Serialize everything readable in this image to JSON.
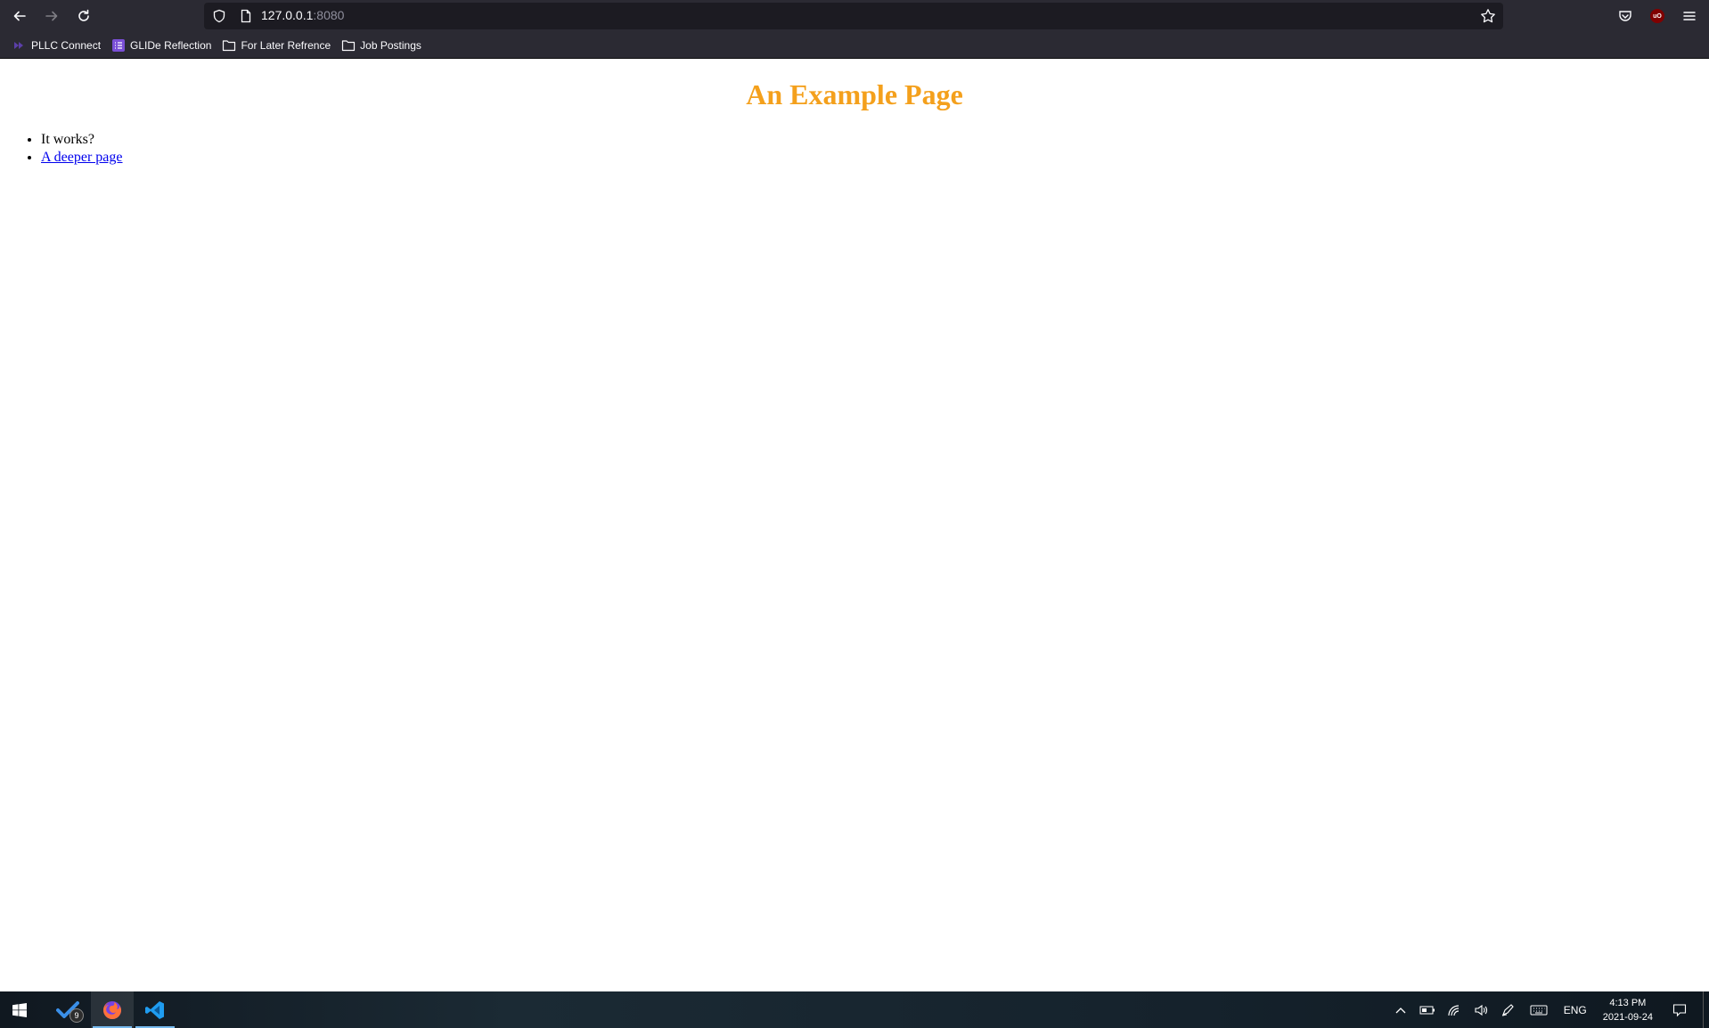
{
  "browser": {
    "url_host": "127.0.0.1",
    "url_port": ":8080",
    "bookmarks": [
      {
        "label": "PLLC Connect",
        "icon": "pllc-icon"
      },
      {
        "label": "GLIDe Reflection",
        "icon": "list-icon"
      },
      {
        "label": "For Later Refrence",
        "icon": "folder-icon"
      },
      {
        "label": "Job Postings",
        "icon": "folder-icon"
      }
    ]
  },
  "page": {
    "title": "An Example Page",
    "items": [
      "It works?"
    ],
    "link": "A deeper page",
    "title_color": "#f4a01c",
    "link_color": "#0000ee"
  },
  "taskbar": {
    "badge_count": "9",
    "language": "ENG",
    "time": "4:13 PM",
    "date": "2021-09-24"
  },
  "colors": {
    "chrome_bg": "#2b2a33",
    "urlbar_bg": "#1c1b22",
    "taskbar_accent": "#76b9ed"
  }
}
